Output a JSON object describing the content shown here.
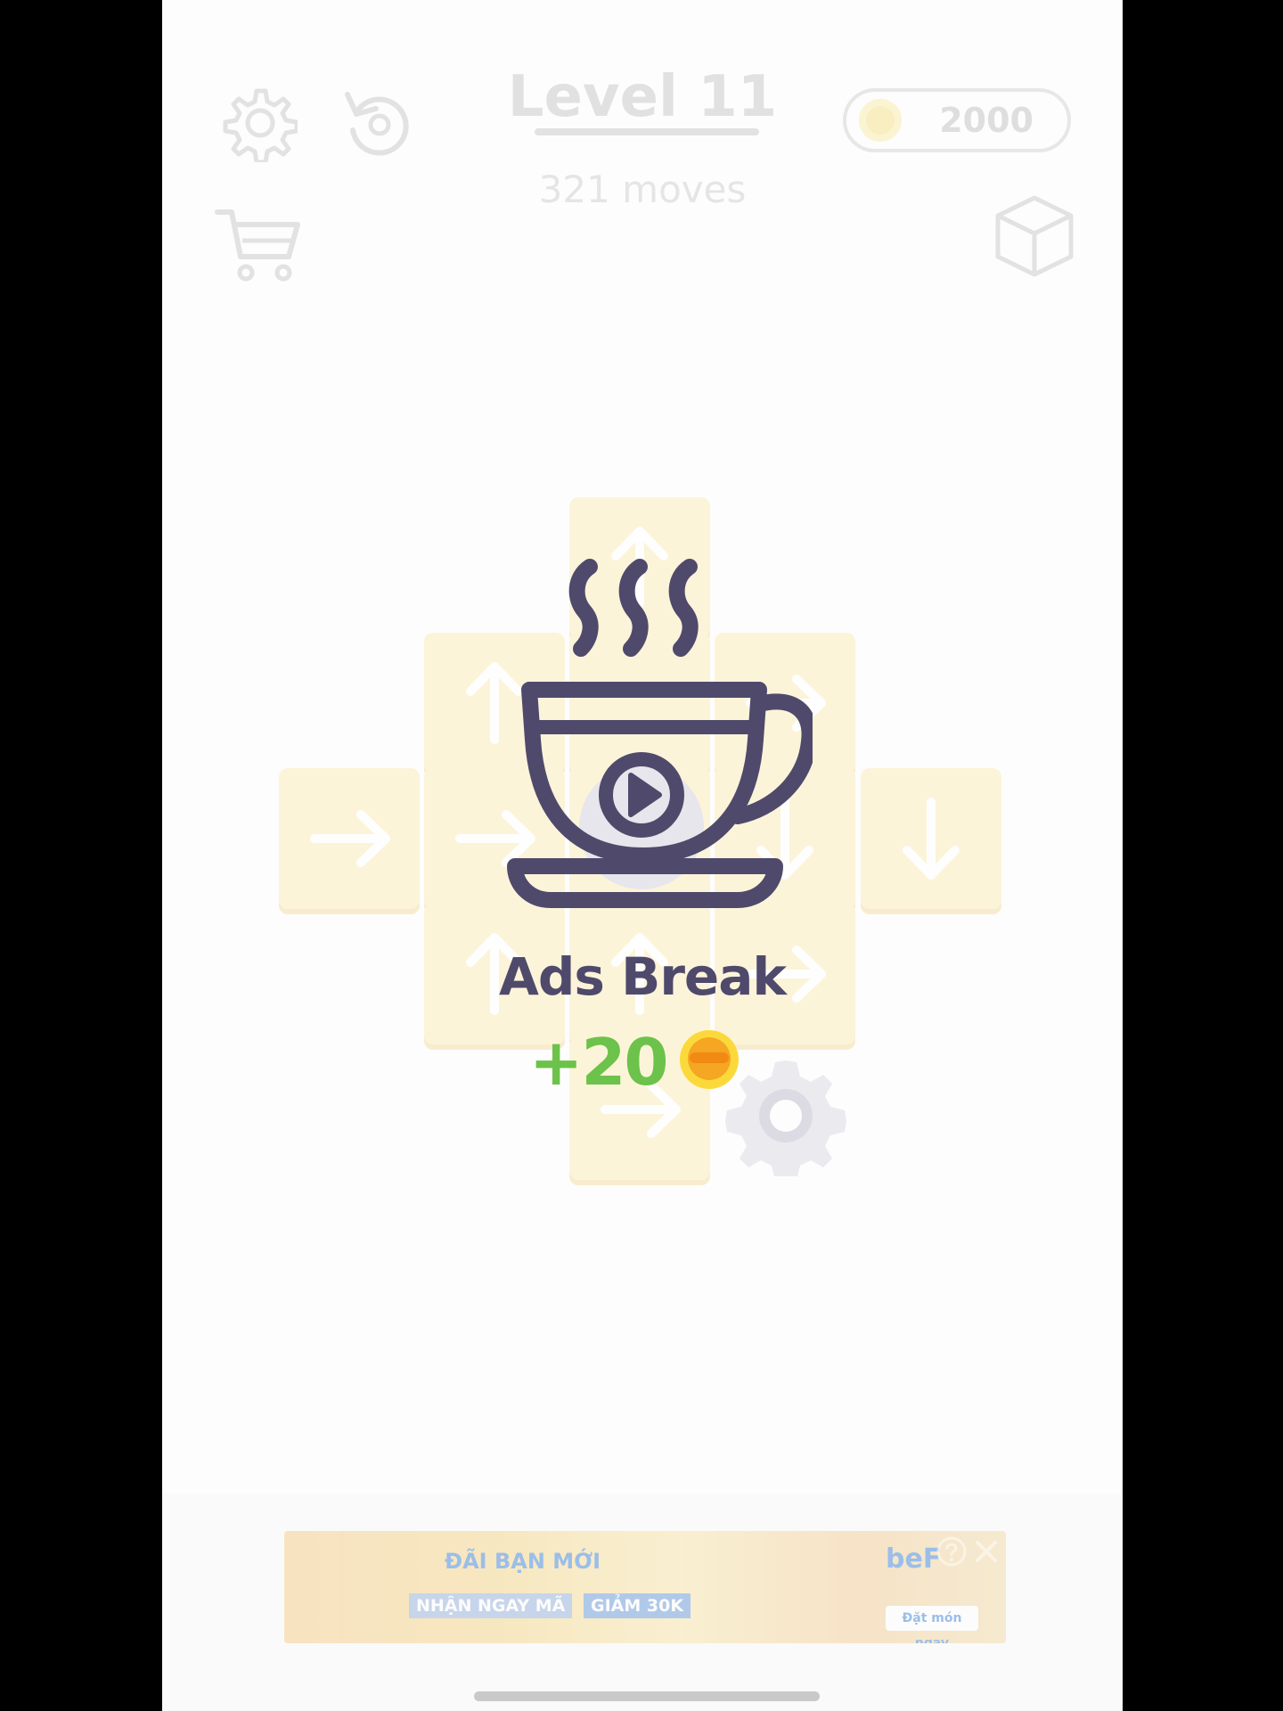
{
  "hud": {
    "level_title": "Level 11",
    "moves": "321 moves",
    "coins": "2000",
    "icons": [
      "gear-icon",
      "undo-icon",
      "cart-icon",
      "cube-icon"
    ]
  },
  "board": {
    "tiles": [
      {
        "arrow": "up"
      },
      {
        "arrow": "up"
      },
      {
        "arrow": "right"
      },
      {
        "arrow": "right"
      },
      {
        "arrow": "right"
      },
      {
        "arrow": "none"
      },
      {
        "arrow": "down"
      },
      {
        "arrow": "down"
      },
      {
        "arrow": "up"
      },
      {
        "arrow": "up"
      },
      {
        "arrow": "right"
      },
      {
        "arrow": "right"
      }
    ]
  },
  "popup": {
    "title": "Ads Break",
    "reward": "+20",
    "icon": "coffee-cup-play-icon",
    "colors": {
      "title": "#4f4a6b",
      "reward": "#6cc24a",
      "coin": "#f5a623"
    }
  },
  "ad": {
    "line1": "ĐÃI BẠN MỚI",
    "line2": "NHẬN NGAY MÃ",
    "line3": "GIẢM 30K",
    "brand": "beF",
    "cta": "Đặt món ngay"
  }
}
